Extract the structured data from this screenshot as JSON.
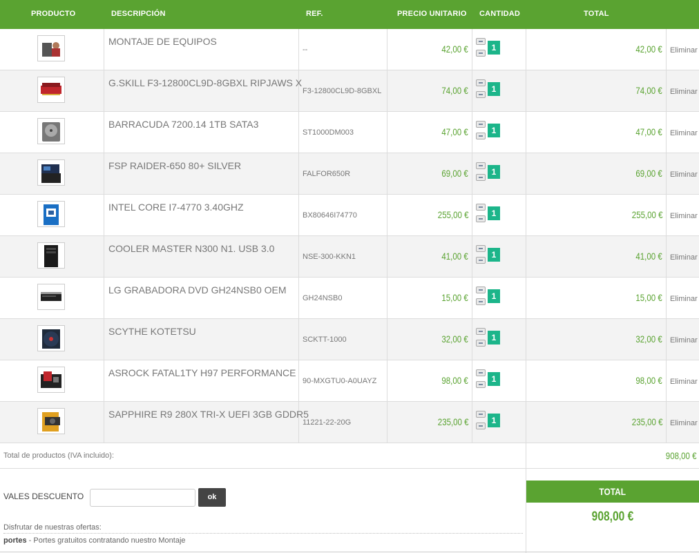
{
  "header": {
    "producto": "PRODUCTO",
    "descripcion": "DESCRIPCIÓN",
    "ref": "REF.",
    "precio": "PRECIO UNITARIO",
    "cantidad": "CANTIDAD",
    "total": "TOTAL"
  },
  "items": [
    {
      "description": "MONTAJE DE EQUIPOS",
      "ref": "--",
      "price": "42,00 €",
      "qty": "1",
      "total": "42,00 €",
      "delete_label": "Eliminar",
      "thumb_icon": "pc-assembly-icon"
    },
    {
      "description": "G.SKILL F3-12800CL9D-8GBXL RIPJAWS X",
      "ref": "F3-12800CL9D-8GBXL",
      "price": "74,00 €",
      "qty": "1",
      "total": "74,00 €",
      "delete_label": "Eliminar",
      "thumb_icon": "ram-icon"
    },
    {
      "description": "BARRACUDA 7200.14 1TB SATA3",
      "ref": "ST1000DM003",
      "price": "47,00 €",
      "qty": "1",
      "total": "47,00 €",
      "delete_label": "Eliminar",
      "thumb_icon": "hard-drive-icon"
    },
    {
      "description": "FSP RAIDER-650 80+ SILVER",
      "ref": "FALFOR650R",
      "price": "69,00 €",
      "qty": "1",
      "total": "69,00 €",
      "delete_label": "Eliminar",
      "thumb_icon": "power-supply-icon"
    },
    {
      "description": "INTEL CORE I7-4770 3.40GHZ",
      "ref": "BX80646I74770",
      "price": "255,00 €",
      "qty": "1",
      "total": "255,00 €",
      "delete_label": "Eliminar",
      "thumb_icon": "cpu-box-icon"
    },
    {
      "description": "COOLER MASTER N300 N1. USB 3.0",
      "ref": "NSE-300-KKN1",
      "price": "41,00 €",
      "qty": "1",
      "total": "41,00 €",
      "delete_label": "Eliminar",
      "thumb_icon": "pc-case-icon"
    },
    {
      "description": "LG GRABADORA DVD GH24NSB0 OEM",
      "ref": "GH24NSB0",
      "price": "15,00 €",
      "qty": "1",
      "total": "15,00 €",
      "delete_label": "Eliminar",
      "thumb_icon": "dvd-drive-icon"
    },
    {
      "description": "SCYTHE KOTETSU",
      "ref": "SCKTT-1000",
      "price": "32,00 €",
      "qty": "1",
      "total": "32,00 €",
      "delete_label": "Eliminar",
      "thumb_icon": "cpu-cooler-icon"
    },
    {
      "description": "ASROCK FATAL1TY H97 PERFORMANCE",
      "ref": "90-MXGTU0-A0UAYZ",
      "price": "98,00 €",
      "qty": "1",
      "total": "98,00 €",
      "delete_label": "Eliminar",
      "thumb_icon": "motherboard-icon"
    },
    {
      "description": "SAPPHIRE R9 280X TRI-X UEFI 3GB GDDR5",
      "ref": "11221-22-20G",
      "price": "235,00 €",
      "qty": "1",
      "total": "235,00 €",
      "delete_label": "Eliminar",
      "thumb_icon": "graphics-card-icon"
    }
  ],
  "summary": {
    "label": "Total de productos (IVA incluido):",
    "value": "908,00 €"
  },
  "vales": {
    "label": "VALES DESCUENTO",
    "input_value": "",
    "button": "ok"
  },
  "offers": {
    "label": "Disfrutar de nuestras ofertas:",
    "name": "portes",
    "text": " - Portes gratuitos contratando nuestro Montaje"
  },
  "grand_total": {
    "label": "TOTAL",
    "value": "908,00 €"
  }
}
